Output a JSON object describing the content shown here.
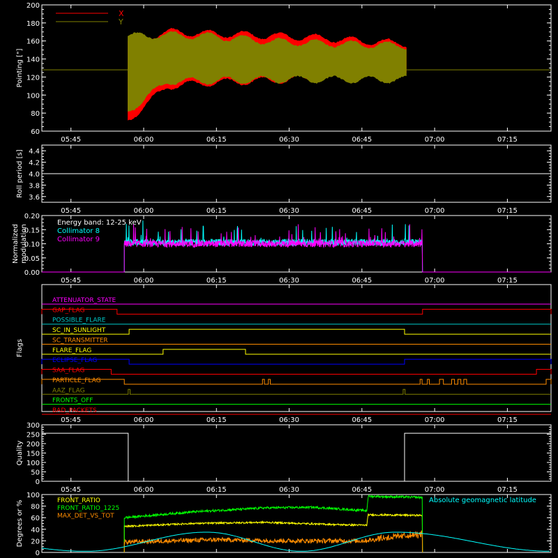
{
  "chart_data": [
    {
      "type": "line",
      "name": "pointing",
      "ylabel": "Pointing [\"]",
      "ylim": [
        60,
        200
      ],
      "yticks": [
        60,
        80,
        100,
        120,
        140,
        160,
        180,
        200
      ],
      "xticks": [
        "05:45",
        "06:00",
        "06:15",
        "06:30",
        "06:45",
        "07:00",
        "07:15"
      ],
      "xlim_minutes": [
        339,
        444
      ],
      "data_start_minute": 356.7,
      "data_end_minute": 414.2,
      "series": [
        {
          "name": "X",
          "color": "#ff0000",
          "lower": [
            72,
            110,
            114,
            116,
            118,
            119,
            120
          ],
          "upper": [
            160,
            170,
            168,
            166,
            164,
            160,
            157
          ]
        },
        {
          "name": "Y",
          "color": "#808000",
          "lower": [
            82,
            115,
            116,
            117,
            117,
            117,
            117
          ],
          "upper": [
            165,
            167,
            165,
            160,
            158,
            156,
            155
          ],
          "baseline": 128
        }
      ],
      "x_knots_minutes": [
        356.7,
        365,
        375,
        385,
        395,
        405,
        414.2
      ]
    },
    {
      "type": "line",
      "name": "roll-period",
      "ylabel": "Roll period [s]",
      "ylim": [
        3.5,
        4.5
      ],
      "yticks": [
        "3.6",
        "3.8",
        "4.0",
        "4.2",
        "4.4"
      ],
      "xticks": [
        "05:45",
        "06:00",
        "06:15",
        "06:30",
        "06:45",
        "07:00",
        "07:15"
      ],
      "series": [
        {
          "name": "",
          "color": "#ffffff",
          "value": 4.0
        }
      ]
    },
    {
      "type": "line",
      "name": "modulation",
      "ylabel": "Normalized modulation",
      "ylabel_lines": [
        "Normalized",
        "modulation"
      ],
      "ylim": [
        0.0,
        0.2
      ],
      "yticks": [
        "0.00",
        "0.05",
        "0.10",
        "0.15",
        "0.20"
      ],
      "xticks": [
        "05:45",
        "06:00",
        "06:15",
        "06:30",
        "06:45",
        "07:00",
        "07:15"
      ],
      "annotation": "Energy band: 12-25 keV",
      "data_start_minute": 356.0,
      "data_end_minute": 417.5,
      "series": [
        {
          "name": "Collimator 8",
          "color": "#00ffff",
          "mean": 0.105,
          "spread": 0.012
        },
        {
          "name": "Collimator 9",
          "color": "#ff00ff",
          "mean": 0.1,
          "spread": 0.012
        }
      ]
    },
    {
      "type": "line",
      "name": "flags",
      "ylabel": "Flags",
      "xticks": [
        "05:45",
        "06:00",
        "06:15",
        "06:30",
        "06:45",
        "07:00",
        "07:15"
      ],
      "series": [
        {
          "name": "ATTENUATOR_STATE",
          "color": "#ff00ff",
          "segments": []
        },
        {
          "name": "GAP_FLAG",
          "color": "#ff0000",
          "segments": [
            [
              339,
              354.5
            ],
            [
              417.5,
              444
            ]
          ]
        },
        {
          "name": "POSSIBLE_FLARE",
          "color": "#00c8c8",
          "segments": []
        },
        {
          "name": "SC_IN_SUNLIGHT",
          "color": "#ffff00",
          "segments": [
            [
              357,
              413.8
            ]
          ]
        },
        {
          "name": "SC_TRANSMITTER",
          "color": "#ff8c00",
          "segments": []
        },
        {
          "name": "FLARE_FLAG",
          "color": "#ffff00",
          "segments": [
            [
              364,
              381
            ]
          ]
        },
        {
          "name": "ECLIPSE_FLAG",
          "color": "#0000ff",
          "segments": [
            [
              339,
              357
            ],
            [
              413.8,
              444
            ]
          ]
        },
        {
          "name": "SAA_FLAG",
          "color": "#ff0000",
          "segments": [
            [
              339,
              353.3
            ],
            [
              441,
              444
            ]
          ]
        },
        {
          "name": "PARTICLE_FLAG",
          "color": "#ff8c00",
          "segments": [
            [
              339,
              356
            ],
            [
              384.5,
              384.9
            ],
            [
              385.7,
              386.1
            ],
            [
              417,
              417.4
            ],
            [
              418.5,
              418.9
            ],
            [
              421,
              421.8
            ],
            [
              423.5,
              424.1
            ],
            [
              424.8,
              425.4
            ],
            [
              426,
              426.6
            ],
            [
              443,
              444
            ]
          ]
        },
        {
          "name": "AAZ_FLAG",
          "color": "#808000",
          "segments": [
            [
              356.8,
              357.2
            ],
            [
              413.5,
              413.9
            ]
          ]
        },
        {
          "name": "FRONTS_OFF",
          "color": "#00ff00",
          "segments": []
        },
        {
          "name": "BAD_PACKETS",
          "color": "#ff0000",
          "segments": []
        }
      ]
    },
    {
      "type": "line",
      "name": "quality",
      "ylabel": "Quality",
      "ylim": [
        0,
        300
      ],
      "yticks": [
        0,
        50,
        100,
        150,
        200,
        250,
        300
      ],
      "xticks": [
        "05:45",
        "06:00",
        "06:15",
        "06:30",
        "06:45",
        "07:00",
        "07:15"
      ],
      "series": [
        {
          "name": "",
          "color": "#ffffff",
          "points": [
            [
              339,
              255
            ],
            [
              356.8,
              255
            ],
            [
              356.8,
              0
            ],
            [
              413.8,
              0
            ],
            [
              413.8,
              255
            ],
            [
              444,
              255
            ]
          ]
        }
      ]
    },
    {
      "type": "line",
      "name": "ratios",
      "ylabel": "Degrees or %",
      "ylim": [
        0,
        100
      ],
      "yticks": [
        0,
        20,
        40,
        60,
        80,
        100
      ],
      "xticks": [
        "05:45",
        "06:00",
        "06:15",
        "06:30",
        "06:45",
        "07:00",
        "07:15"
      ],
      "data_start_minute": 356.0,
      "data_end_minute": 417.5,
      "series": [
        {
          "name": "FRONT_RATIO",
          "color": "#ffff00",
          "knots": [
            [
              356,
              45
            ],
            [
              370,
              50
            ],
            [
              385,
              52
            ],
            [
              400,
              48
            ],
            [
              406,
              47
            ],
            [
              406.3,
              65
            ],
            [
              417.5,
              64
            ]
          ]
        },
        {
          "name": "FRONT_RATIO_1225",
          "color": "#00ff00",
          "knots": [
            [
              356,
              60
            ],
            [
              370,
              70
            ],
            [
              385,
              77
            ],
            [
              395,
              78
            ],
            [
              406,
              72
            ],
            [
              406.3,
              97
            ],
            [
              417.5,
              95
            ]
          ]
        },
        {
          "name": "MAX_DET_VS_TOT",
          "color": "#ff8c00",
          "knots": [
            [
              356,
              18
            ],
            [
              375,
              22
            ],
            [
              390,
              20
            ],
            [
              405,
              20
            ],
            [
              417.5,
              30
            ]
          ]
        },
        {
          "name": "Absolute geomagnetic latitude",
          "color": "#00ffff",
          "peaks": [
            [
              373,
              33
            ],
            [
              412,
              33
            ]
          ],
          "troughs": [
            [
              348,
              0
            ],
            [
              392.5,
              0
            ],
            [
              444,
              0
            ]
          ]
        }
      ]
    }
  ]
}
